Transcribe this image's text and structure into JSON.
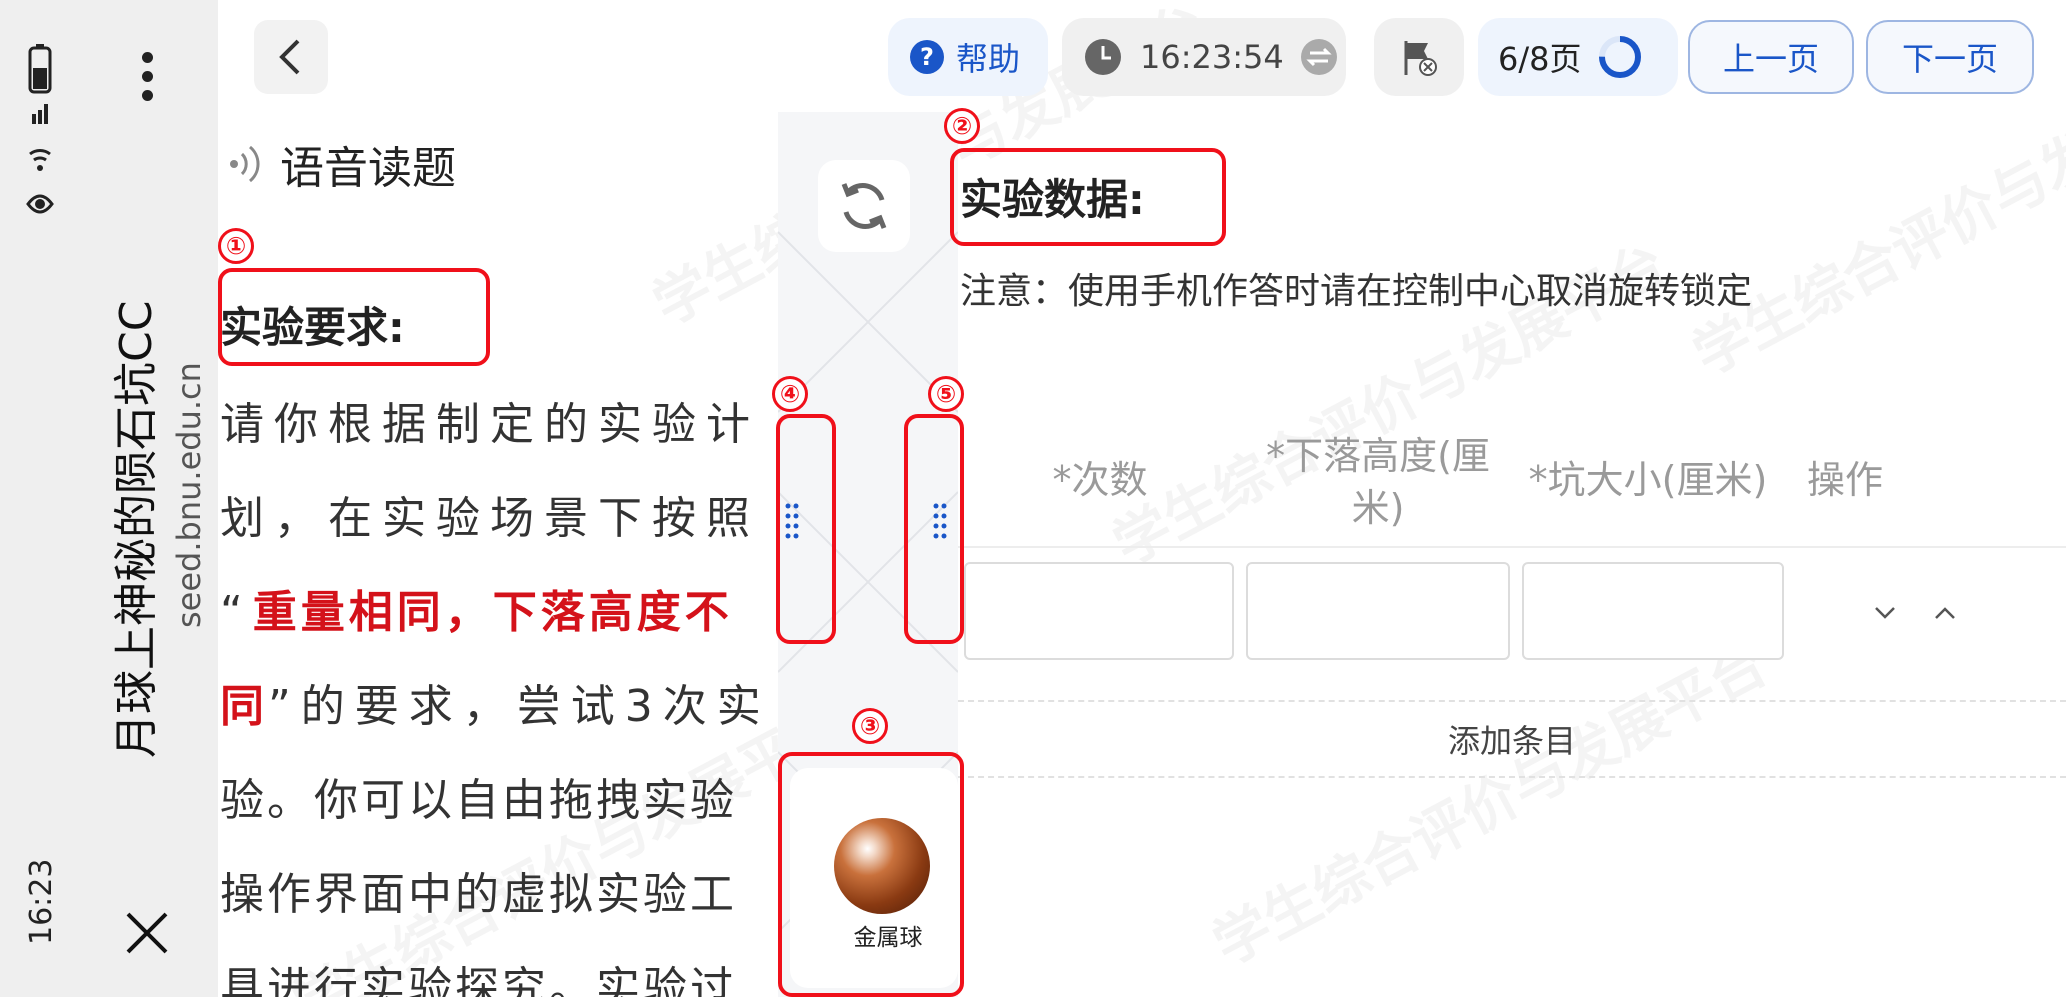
{
  "status_bar": {
    "time": "16:23"
  },
  "app": {
    "title": "月球上神秘的陨石坑CC",
    "url": "seed.bnu.edu.cn"
  },
  "toolbar": {
    "help_label": "帮助",
    "timer": "16:23:54",
    "page_indicator": "6/8页",
    "prev_label": "上一页",
    "next_label": "下一页"
  },
  "left_panel": {
    "voice_read_label": "语音读题",
    "requirement_title": "实验要求:",
    "text_lines": {
      "l1": "请你根据制定的实验计",
      "l2": "划，在实验场景下按照",
      "l3_open": "“",
      "l3_red": "重量相同，下落高度不",
      "l4_red": "同",
      "l4_rest": "”的要求，尝试3次实",
      "l5": "验。你可以自由拖拽实验",
      "l6": "操作界面中的虚拟实验工",
      "l7": "具进行实验探究。实验过"
    }
  },
  "tool_panel": {
    "item_label": "金属球"
  },
  "right_panel": {
    "data_title": "实验数据:",
    "notice": "注意：使用手机作答时请在控制中心取消旋转锁定",
    "table": {
      "headers": [
        "*次数",
        "*下落高度(厘米)",
        "*坑大小(厘米)",
        "操作"
      ],
      "row_values": [
        "",
        "",
        ""
      ]
    },
    "add_item_label": "添加条目"
  },
  "annotations": [
    "①",
    "②",
    "③",
    "④",
    "⑤"
  ],
  "watermark": "学生综合评价与发展平台",
  "colors": {
    "accent_blue": "#1a56c8",
    "annotation_red": "#f0101a",
    "emphasis_red": "#d4121a"
  }
}
